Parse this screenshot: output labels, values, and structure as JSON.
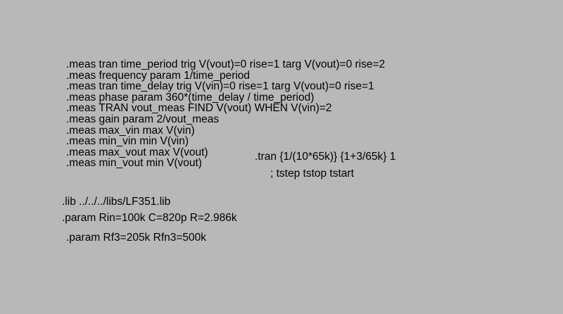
{
  "schematic": {
    "meas_directives": [
      ".meas tran time_period trig V(vout)=0 rise=1 targ V(vout)=0 rise=2",
      ".meas frequency param 1/time_period",
      ".meas tran time_delay trig V(vin)=0 rise=1 targ V(vout)=0 rise=1",
      ".meas phase param 360*(time_delay / time_period)",
      ".meas TRAN vout_meas FIND V(vout) WHEN V(vin)=2",
      ".meas gain param 2/vout_meas",
      ".meas max_vin max V(vin)",
      ".meas min_vin min V(vin)",
      ".meas max_vout max V(vout)",
      ".meas min_vout min V(vout)"
    ],
    "tran_directive": ".tran {1/(10*65k)} {1+3/65k} 1",
    "tran_comment": "; tstep tstop tstart",
    "lib_directive": ".lib ../../../libs/LF351.lib",
    "param_directive_1": ".param Rin=100k C=820p R=2.986k",
    "param_directive_2": ".param Rf3=205k Rfn3=500k"
  },
  "colors": {
    "background": "#b8b8b8",
    "text": "#000000"
  }
}
